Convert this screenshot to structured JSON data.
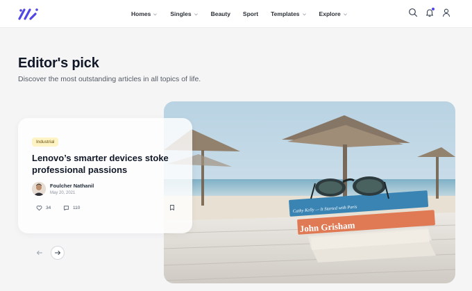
{
  "header": {
    "nav": [
      {
        "label": "Homes",
        "dropdown": true
      },
      {
        "label": "Singles",
        "dropdown": true
      },
      {
        "label": "Beauty",
        "dropdown": false
      },
      {
        "label": "Sport",
        "dropdown": false
      },
      {
        "label": "Templates",
        "dropdown": true
      },
      {
        "label": "Explore",
        "dropdown": true
      }
    ],
    "icons": [
      "search-icon",
      "bell-icon",
      "user-icon"
    ],
    "brand_color": "#4f46e5"
  },
  "section": {
    "title": "Editor's pick",
    "subtitle": "Discover the most outstanding articles in all topics of life."
  },
  "card": {
    "category": "Industrial",
    "title_line1": "Lenovo’s smarter devices stoke",
    "title_line2": "professional passions",
    "author": "Foulcher Nathanil",
    "date": "May 20, 2021",
    "likes": "34",
    "comments": "110"
  },
  "hero": {
    "book_top_spine": "Cathy Kelly — It Started with Paris",
    "book_middle_spine": "John Grisham"
  }
}
